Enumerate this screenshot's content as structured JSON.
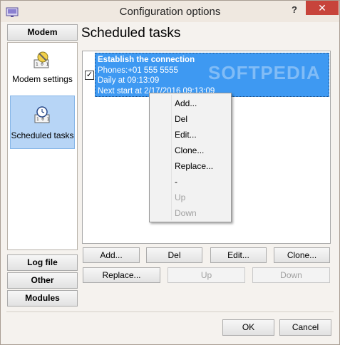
{
  "window": {
    "title": "Configuration options",
    "help_label": "?",
    "close_label": "✕"
  },
  "sidebar": {
    "modem_header": "Modem",
    "items": [
      {
        "label": "Modem settings",
        "icon": "modem-settings-icon"
      },
      {
        "label": "Scheduled tasks",
        "icon": "clock-icon",
        "selected": true
      }
    ],
    "log_file": "Log file",
    "other": "Other",
    "modules": "Modules"
  },
  "main": {
    "title": "Scheduled tasks",
    "tasks": [
      {
        "checked": true,
        "name": "Establish the connection",
        "phones": "Phones:+01 555 5555",
        "schedule": "Daily at 09:13:09",
        "next_start": "Next start at 2/17/2016 09:13:09"
      }
    ],
    "watermark": "SOFTPEDIA"
  },
  "context_menu": {
    "items": [
      {
        "label": "Add...",
        "enabled": true
      },
      {
        "label": "Del",
        "enabled": true
      },
      {
        "label": "Edit...",
        "enabled": true
      },
      {
        "label": "Clone...",
        "enabled": true
      },
      {
        "label": "Replace...",
        "enabled": true
      },
      {
        "label": "-",
        "enabled": true
      },
      {
        "label": "Up",
        "enabled": false
      },
      {
        "label": "Down",
        "enabled": false
      }
    ]
  },
  "buttons": {
    "add": "Add...",
    "del": "Del",
    "edit": "Edit...",
    "clone": "Clone...",
    "replace": "Replace...",
    "up": "Up",
    "down": "Down",
    "ok": "OK",
    "cancel": "Cancel"
  },
  "colors": {
    "selection": "#3e99f2",
    "sidebar_selected": "#b7d5f6",
    "close_button": "#c7443b"
  }
}
